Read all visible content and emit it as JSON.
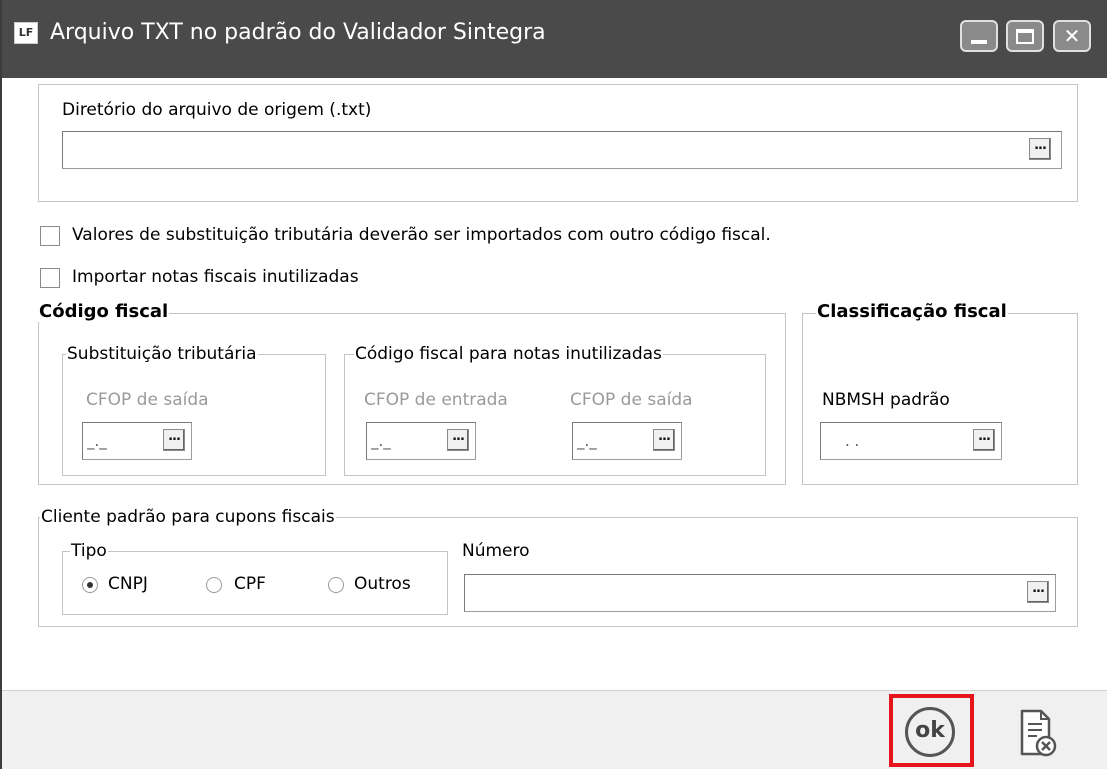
{
  "window": {
    "title": "Arquivo TXT no padrão do Validador Sintegra",
    "app_icon_text": "LF"
  },
  "source_dir": {
    "label": "Diretório do arquivo de origem  (.txt)",
    "value": "",
    "button": "..."
  },
  "options": {
    "substitution_label": "Valores de substituição tributária deverão ser importados com outro código fiscal.",
    "substitution_checked": false,
    "import_voided_label": "Importar notas fiscais inutilizadas",
    "import_voided_checked": false
  },
  "codigo_fiscal": {
    "title": "Código fiscal",
    "substituicao": {
      "title": "Substituição tributária",
      "cfop_saida_label": "CFOP de saída",
      "cfop_saida_value": "_._"
    },
    "inutilizadas": {
      "title": "Código fiscal para notas inutilizadas",
      "cfop_entrada_label": "CFOP de entrada",
      "cfop_entrada_value": "_._",
      "cfop_saida_label": "CFOP de saída",
      "cfop_saida_value": "_._"
    }
  },
  "classificacao_fiscal": {
    "title": "Classificação fiscal",
    "nbmsh_label": "NBMSH padrão",
    "nbmsh_value": ". ."
  },
  "cliente_padrao": {
    "title": "Cliente padrão para cupons fiscais",
    "tipo_title": "Tipo",
    "tipo_options": [
      "CNPJ",
      "CPF",
      "Outros"
    ],
    "tipo_selected": "CNPJ",
    "numero_label": "Número",
    "numero_value": ""
  },
  "footer": {
    "ok_label": "ok"
  },
  "colors": {
    "titlebar": "#4a4a4a",
    "highlight": "#e8141c"
  }
}
